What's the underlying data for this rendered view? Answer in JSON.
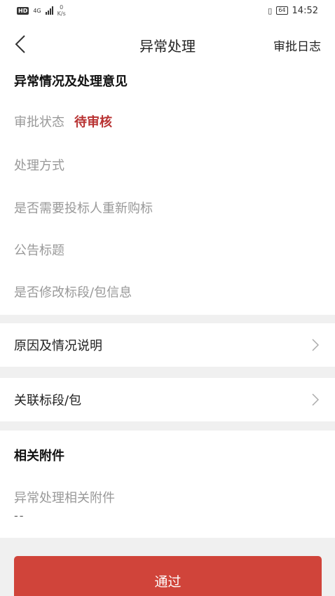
{
  "status_bar": {
    "network_type": "4G",
    "speed_value": "0",
    "speed_unit": "K/s",
    "battery": "64",
    "time": "14:52"
  },
  "header": {
    "title": "异常处理",
    "action": "审批日志"
  },
  "info_section": {
    "title": "异常情况及处理意见",
    "approval_status_label": "审批状态",
    "approval_status_value": "待审核",
    "fields": [
      "处理方式",
      "是否需要投标人重新购标",
      "公告标题",
      "是否修改标段/包信息"
    ]
  },
  "links": [
    "原因及情况说明",
    "关联标段/包"
  ],
  "attachments": {
    "title": "相关附件",
    "label": "异常处理相关附件",
    "value": "--"
  },
  "actions": {
    "approve_label": "通过"
  },
  "colors": {
    "accent_red": "#d0443a",
    "status_red": "#b83232"
  }
}
